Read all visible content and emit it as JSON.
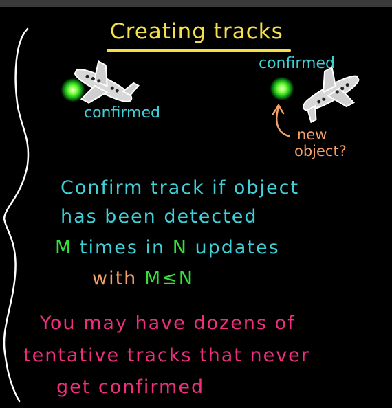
{
  "slide": {
    "title": "Creating tracks",
    "confirmed_left": "confirmed",
    "confirmed_right": "confirmed",
    "new_object_line1": "new",
    "new_object_line2": "object?",
    "confirm_line1": "Confirm track if object",
    "confirm_line2": "has been detected",
    "times_m": "M",
    "times_text1": " times in ",
    "times_n": "N",
    "times_text2": " updates",
    "with_text": "with ",
    "with_m": "M",
    "with_le": "≤",
    "with_n": "N",
    "dozens_line1": "You may have dozens of",
    "dozens_line2": "tentative tracks that never",
    "dozens_line3": "get confirmed"
  },
  "colors": {
    "background": "#000000",
    "title": "#f4e04d",
    "cyan": "#3fd0d8",
    "orange": "#f4a06a",
    "green": "#35e03a",
    "pink": "#ee2f7d"
  }
}
